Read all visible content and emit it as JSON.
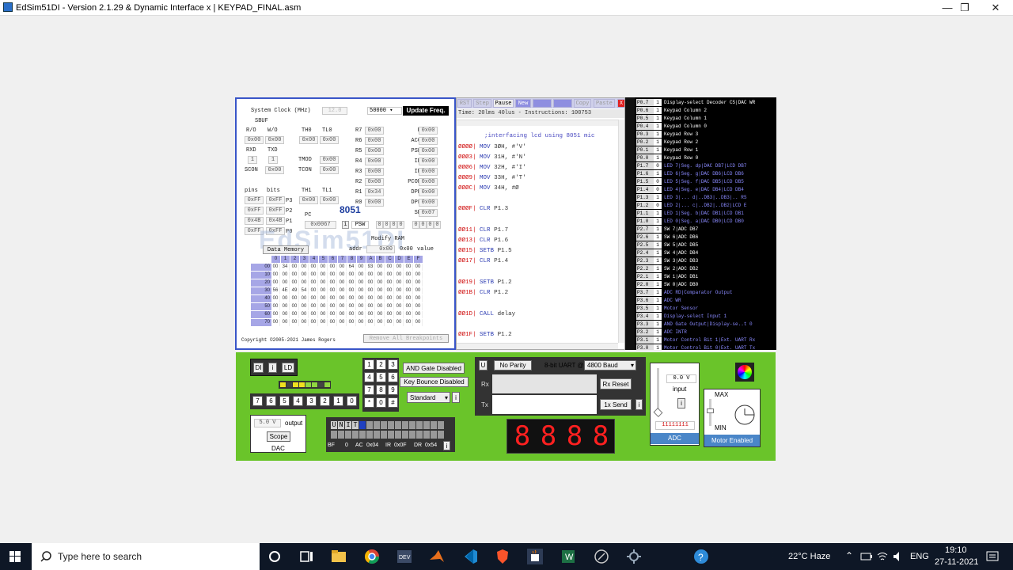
{
  "window": {
    "title": "EdSim51DI - Version 2.1.29 & Dynamic Interface x | KEYPAD_FINAL.asm",
    "minimize": "—",
    "maximize": "❐",
    "close": "✕"
  },
  "regs": {
    "system_clock_label": "System Clock (MHz)",
    "system_clock_value": "12.0",
    "baud_value": "50000",
    "update_freq": "Update Freq.",
    "sbuf_label": "SBUF",
    "ro_label": "R/O",
    "wo_label": "W/O",
    "ro_value": "0x00",
    "wo_value": "0x00",
    "th0_label": "TH0",
    "tl0_label": "TL0",
    "th0_value": "0x00",
    "tl0_value": "0x00",
    "rxd_label": "RXD",
    "txd_label": "TXD",
    "rxd_value": "1",
    "txd_value": "1",
    "tmod_label": "TMOD",
    "tmod_value": "0x00",
    "scon_label": "SCON",
    "scon_value": "0x00",
    "tcon_label": "TCON",
    "tcon_value": "0x00",
    "th1_label": "TH1",
    "tl1_label": "TL1",
    "th1_value": "0x00",
    "tl1_value": "0x00",
    "pins_label": "pins",
    "bits_label": "bits",
    "ports": [
      {
        "pins": "0xFF",
        "bits": "0xFF",
        "name": "P3"
      },
      {
        "pins": "0xFF",
        "bits": "0xFF",
        "name": "P2"
      },
      {
        "pins": "0x4B",
        "bits": "0x4B",
        "name": "P1"
      },
      {
        "pins": "0xFF",
        "bits": "0xFF",
        "name": "P0"
      }
    ],
    "rbank": [
      {
        "name": "R7",
        "value": "0x00"
      },
      {
        "name": "R6",
        "value": "0x00"
      },
      {
        "name": "R5",
        "value": "0x00"
      },
      {
        "name": "R4",
        "value": "0x00"
      },
      {
        "name": "R3",
        "value": "0x00"
      },
      {
        "name": "R2",
        "value": "0x00"
      },
      {
        "name": "R1",
        "value": "0x34"
      },
      {
        "name": "R0",
        "value": "0x00"
      }
    ],
    "sfr": [
      {
        "name": "B",
        "value": "0x00"
      },
      {
        "name": "ACC",
        "value": "0x00"
      },
      {
        "name": "PSW",
        "value": "0x00"
      },
      {
        "name": "IP",
        "value": "0x00"
      },
      {
        "name": "IE",
        "value": "0x00"
      },
      {
        "name": "PCON",
        "value": "0x00"
      },
      {
        "name": "DPH",
        "value": "0x00"
      },
      {
        "name": "DPL",
        "value": "0x00"
      },
      {
        "name": "SP",
        "value": "0x07"
      }
    ],
    "chip": "8051",
    "pc_label": "PC",
    "pc_value": "0x0067",
    "psw_label": "PSW",
    "psw_bits": [
      "0",
      "0",
      "0",
      "0",
      "0",
      "0",
      "0",
      "0"
    ],
    "watermark": "EdSim51DI",
    "modify_ram": "Modify RAM",
    "data_memory": "Data Memory",
    "addr_label": "addr",
    "addr_value": "0x00",
    "value_value": "0x00",
    "value_label": "value",
    "copyright": "Copyright ©2005-2021 James Rogers",
    "remove_bp": "Remove All Breakpoints"
  },
  "memory": {
    "cols": [
      "0",
      "1",
      "2",
      "3",
      "4",
      "5",
      "6",
      "7",
      "8",
      "9",
      "A",
      "B",
      "C",
      "D",
      "E",
      "F"
    ],
    "rows": [
      {
        "addr": "00",
        "cells": [
          "00",
          "34",
          "00",
          "00",
          "00",
          "00",
          "00",
          "00",
          "64",
          "00",
          "93",
          "00",
          "00",
          "00",
          "00",
          "00"
        ]
      },
      {
        "addr": "10",
        "cells": [
          "00",
          "00",
          "00",
          "00",
          "00",
          "00",
          "00",
          "00",
          "00",
          "00",
          "00",
          "00",
          "00",
          "00",
          "00",
          "00"
        ]
      },
      {
        "addr": "20",
        "cells": [
          "00",
          "00",
          "00",
          "00",
          "00",
          "00",
          "00",
          "00",
          "00",
          "00",
          "00",
          "00",
          "00",
          "00",
          "00",
          "00"
        ]
      },
      {
        "addr": "30",
        "cells": [
          "56",
          "4E",
          "49",
          "54",
          "00",
          "00",
          "00",
          "00",
          "00",
          "00",
          "00",
          "00",
          "00",
          "00",
          "00",
          "00"
        ]
      },
      {
        "addr": "40",
        "cells": [
          "00",
          "00",
          "00",
          "00",
          "00",
          "00",
          "00",
          "00",
          "00",
          "00",
          "00",
          "00",
          "00",
          "00",
          "00",
          "00"
        ]
      },
      {
        "addr": "50",
        "cells": [
          "00",
          "00",
          "00",
          "00",
          "00",
          "00",
          "00",
          "00",
          "00",
          "00",
          "00",
          "00",
          "00",
          "00",
          "00",
          "00"
        ]
      },
      {
        "addr": "60",
        "cells": [
          "00",
          "00",
          "00",
          "00",
          "00",
          "00",
          "00",
          "00",
          "00",
          "00",
          "00",
          "00",
          "00",
          "00",
          "00",
          "00"
        ]
      },
      {
        "addr": "70",
        "cells": [
          "00",
          "00",
          "00",
          "00",
          "00",
          "00",
          "00",
          "00",
          "00",
          "00",
          "00",
          "00",
          "00",
          "00",
          "00",
          "00"
        ]
      }
    ]
  },
  "code": {
    "toolbar": [
      "RST",
      "Step",
      "Pause",
      "New",
      "",
      "",
      "Copy",
      "Paste"
    ],
    "close_x": "X",
    "status": "Time: 20lms 40lus - Instructions: 100753",
    "comment": ";interfacing lcd using 8051 mic",
    "lines": [
      {
        "addr": "ØØØØ|",
        "op": "MOV",
        "arg": "3ØH, #'V'"
      },
      {
        "addr": "ØØØ3|",
        "op": "MOV",
        "arg": "31H, #'N'"
      },
      {
        "addr": "ØØØ6|",
        "op": "MOV",
        "arg": "32H, #'I'"
      },
      {
        "addr": "ØØØ9|",
        "op": "MOV",
        "arg": "33H, #'T'"
      },
      {
        "addr": "ØØØC|",
        "op": "MOV",
        "arg": "34H, #Ø"
      },
      {
        "addr": "ØØØF|",
        "op": "CLR",
        "arg": "P1.3"
      },
      {
        "addr": "ØØ11|",
        "op": "CLR",
        "arg": "P1.7"
      },
      {
        "addr": "ØØ13|",
        "op": "CLR",
        "arg": "P1.6"
      },
      {
        "addr": "ØØ15|",
        "op": "SETB",
        "arg": "P1.5"
      },
      {
        "addr": "ØØ17|",
        "op": "CLR",
        "arg": "P1.4"
      },
      {
        "addr": "ØØ19|",
        "op": "SETB",
        "arg": "P1.2"
      },
      {
        "addr": "ØØ1B|",
        "op": "CLR",
        "arg": "P1.2"
      },
      {
        "addr": "ØØ1D|",
        "op": "CALL",
        "arg": "delay"
      },
      {
        "addr": "ØØ1F|",
        "op": "SETB",
        "arg": "P1.2"
      }
    ]
  },
  "pins": [
    {
      "pin": "P0.7",
      "val": "1",
      "desc": "Display-select Decoder CS|DAC WR",
      "blue": false
    },
    {
      "pin": "P0.6",
      "val": "1",
      "desc": "Keypad Column 2",
      "blue": false
    },
    {
      "pin": "P0.5",
      "val": "1",
      "desc": "Keypad Column 1",
      "blue": false
    },
    {
      "pin": "P0.4",
      "val": "1",
      "desc": "Keypad Column 0",
      "blue": false
    },
    {
      "pin": "P0.3",
      "val": "1",
      "desc": "Keypad Row 3",
      "blue": false
    },
    {
      "pin": "P0.2",
      "val": "1",
      "desc": "Keypad Row 2",
      "blue": false
    },
    {
      "pin": "P0.1",
      "val": "1",
      "desc": "Keypad Row 1",
      "blue": false
    },
    {
      "pin": "P0.0",
      "val": "1",
      "desc": "Keypad Row 0",
      "blue": false
    },
    {
      "pin": "P1.7",
      "val": "0",
      "desc": "LED 7|Seg. dp|DAC DB7|LCD DB7",
      "blue": true
    },
    {
      "pin": "P1.6",
      "val": "1",
      "desc": "LED 6|Seg. g|DAC DB6|LCD DB6",
      "blue": true
    },
    {
      "pin": "P1.5",
      "val": "0",
      "desc": "LED 5|Seg. f|DAC DB5|LCD DB5",
      "blue": true
    },
    {
      "pin": "P1.4",
      "val": "0",
      "desc": "LED 4|Seg. e|DAC DB4|LCD DB4",
      "blue": true
    },
    {
      "pin": "P1.3",
      "val": "1",
      "desc": "LED 3|... d|..DB3|..DB3|.. RS",
      "blue": true
    },
    {
      "pin": "P1.2",
      "val": "0",
      "desc": "LED 2|... c|..DB2|..DB2|LCD E",
      "blue": true
    },
    {
      "pin": "P1.1",
      "val": "1",
      "desc": "LED 1|Seg. b|DAC DB1|LCD DB1",
      "blue": true
    },
    {
      "pin": "P1.0",
      "val": "1",
      "desc": "LED 0|Seg. a|DAC DB0|LCD DB0",
      "blue": true
    },
    {
      "pin": "P2.7",
      "val": "1",
      "desc": "SW 7|ADC DB7",
      "blue": false
    },
    {
      "pin": "P2.6",
      "val": "1",
      "desc": "SW 6|ADC DB6",
      "blue": false
    },
    {
      "pin": "P2.5",
      "val": "1",
      "desc": "SW 5|ADC DB5",
      "blue": false
    },
    {
      "pin": "P2.4",
      "val": "1",
      "desc": "SW 4|ADC DB4",
      "blue": false
    },
    {
      "pin": "P2.3",
      "val": "1",
      "desc": "SW 3|ADC DB3",
      "blue": false
    },
    {
      "pin": "P2.2",
      "val": "1",
      "desc": "SW 2|ADC DB2",
      "blue": false
    },
    {
      "pin": "P2.1",
      "val": "1",
      "desc": "SW 1|ADC DB1",
      "blue": false
    },
    {
      "pin": "P2.0",
      "val": "1",
      "desc": "SW 0|ADC DB0",
      "blue": false
    },
    {
      "pin": "P3.7",
      "val": "1",
      "desc": "ADC RD|Comparator Output",
      "blue": true
    },
    {
      "pin": "P3.6",
      "val": "1",
      "desc": "ADC WR",
      "blue": true
    },
    {
      "pin": "P3.5",
      "val": "1",
      "desc": "Motor Sensor",
      "blue": true
    },
    {
      "pin": "P3.4",
      "val": "1",
      "desc": "Display-select Input 1",
      "blue": true
    },
    {
      "pin": "P3.3",
      "val": "1",
      "desc": "AND Gate Output|Display-se..t 0",
      "blue": true
    },
    {
      "pin": "P3.2",
      "val": "1",
      "desc": "ADC INTR",
      "blue": true
    },
    {
      "pin": "P3.1",
      "val": "1",
      "desc": "Motor Control Bit 1|Ext. UART Rx",
      "blue": true
    },
    {
      "pin": "P3.0",
      "val": "1",
      "desc": "Motor Control Bit 0|Ext. UART Tx",
      "blue": true
    }
  ],
  "periph": {
    "dl_buttons": [
      "DI",
      "i",
      "LD"
    ],
    "switches": [
      "7",
      "6",
      "5",
      "4",
      "3",
      "2",
      "1",
      "0"
    ],
    "dac_value": "5.0 V",
    "dac_output": "output",
    "scope": "Scope",
    "dac_label": "DAC",
    "keypad": [
      "1",
      "2",
      "3",
      "4",
      "5",
      "6",
      "7",
      "8",
      "9",
      "*",
      "0",
      "#"
    ],
    "and_gate": "AND Gate Disabled",
    "key_bounce": "Key Bounce Disabled",
    "standard": "Standard",
    "lcd_text": "UNIT",
    "lcd_bf_label": "BF",
    "lcd_bf": "0",
    "lcd_ac_label": "AC",
    "lcd_ac": "0x04",
    "lcd_ir_label": "IR",
    "lcd_ir": "0x0F",
    "lcd_dr_label": "DR",
    "lcd_dr": "0x54",
    "uart_u": "U",
    "parity": "No Parity",
    "uart_bits": "8-bit UART @",
    "baud": "4800 Baud",
    "rx_label": "Rx",
    "tx_label": "Tx",
    "rx_reset": "Rx Reset",
    "tx_send": "1x Send",
    "seg_digits": [
      "8",
      "8",
      "8",
      "8"
    ],
    "adc_value": "0.0 V",
    "adc_input": "input",
    "adc_bits": "11111111",
    "adc_label": "ADC",
    "max_label": "MAX",
    "min_label": "MIN",
    "motor": "Motor Enabled"
  },
  "taskbar": {
    "search_placeholder": "Type here to search",
    "weather": "22°C  Haze",
    "lang": "ENG",
    "time": "19:10",
    "date": "27-11-2021"
  }
}
